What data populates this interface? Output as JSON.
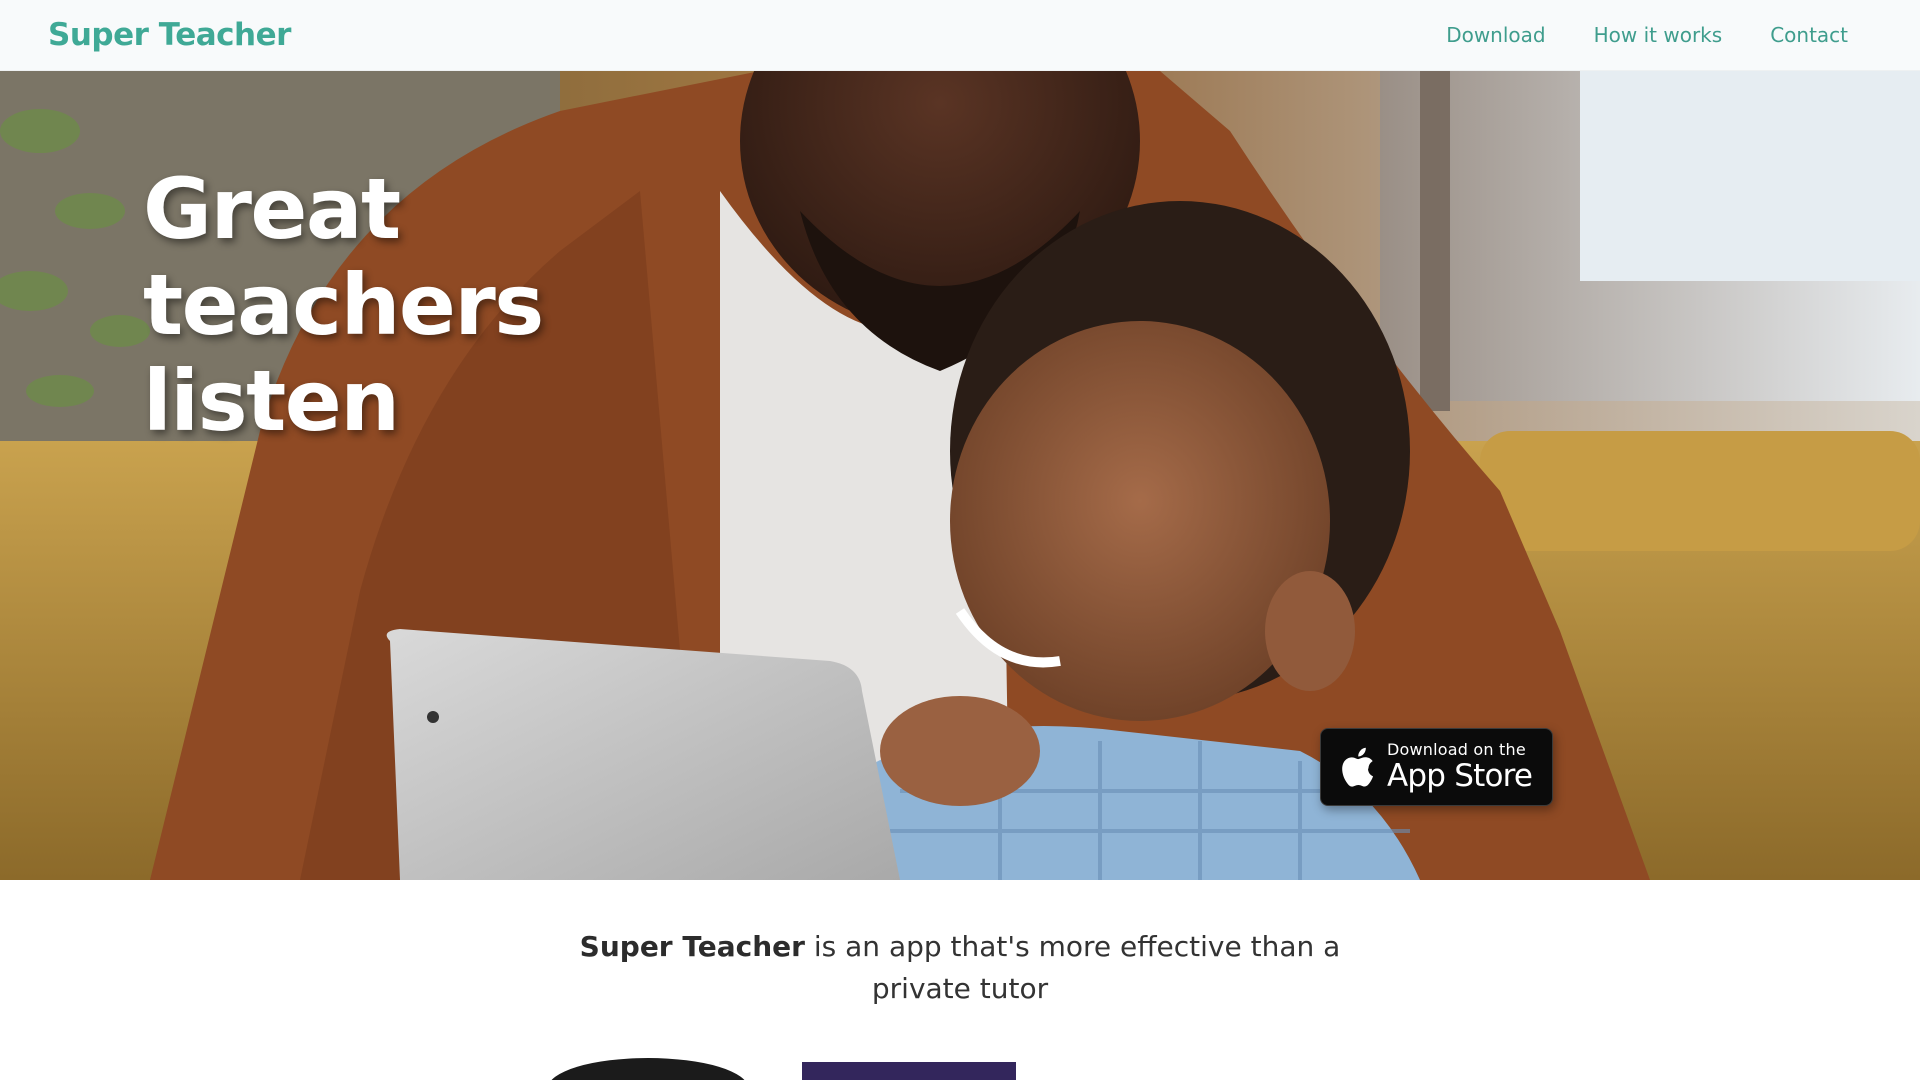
{
  "header": {
    "logo": "Super Teacher",
    "nav": [
      {
        "label": "Download"
      },
      {
        "label": "How it works"
      },
      {
        "label": "Contact"
      }
    ]
  },
  "hero": {
    "title_lines": [
      "Great",
      "teachers",
      "listen"
    ],
    "app_store_badge": {
      "small_text": "Download on the",
      "big_text": "App Store",
      "icon": "apple-icon"
    }
  },
  "intro": {
    "brand": "Super Teacher",
    "text": " is an app that's more effective than a private tutor"
  },
  "colors": {
    "brand": "#3fa996",
    "nav_link": "#3f9d8d",
    "badge_bg": "#0b0b0b"
  }
}
